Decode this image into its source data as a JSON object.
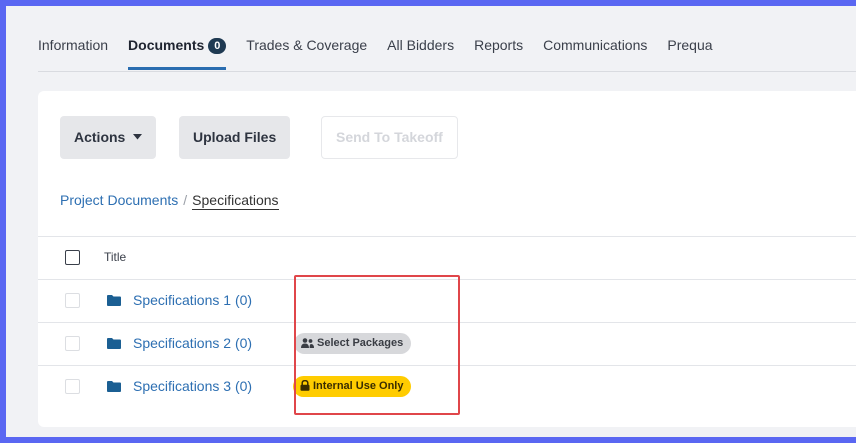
{
  "tabs": [
    {
      "label": "Information"
    },
    {
      "label": "Documents",
      "badge": "0"
    },
    {
      "label": "Trades & Coverage"
    },
    {
      "label": "All Bidders"
    },
    {
      "label": "Reports"
    },
    {
      "label": "Communications"
    },
    {
      "label": "Prequa"
    }
  ],
  "toolbar": {
    "actions_label": "Actions",
    "upload_label": "Upload Files",
    "takeoff_label": "Send To Takeoff"
  },
  "breadcrumb": {
    "root": "Project Documents",
    "separator": "/",
    "current": "Specifications"
  },
  "table": {
    "header_title": "Title",
    "rows": [
      {
        "name": "Specifications 1 (0)",
        "tag": ""
      },
      {
        "name": "Specifications 2 (0)",
        "tag": "Select Packages"
      },
      {
        "name": "Specifications 3 (0)",
        "tag": "Internal Use Only"
      }
    ]
  },
  "colors": {
    "frame_border": "#5a67f2",
    "link": "#2d6fb2",
    "active_tab_underline": "#2a6db0",
    "tag_gray": "#d7d8db",
    "tag_yellow": "#ffcc00",
    "highlight_box": "#e0464a"
  }
}
